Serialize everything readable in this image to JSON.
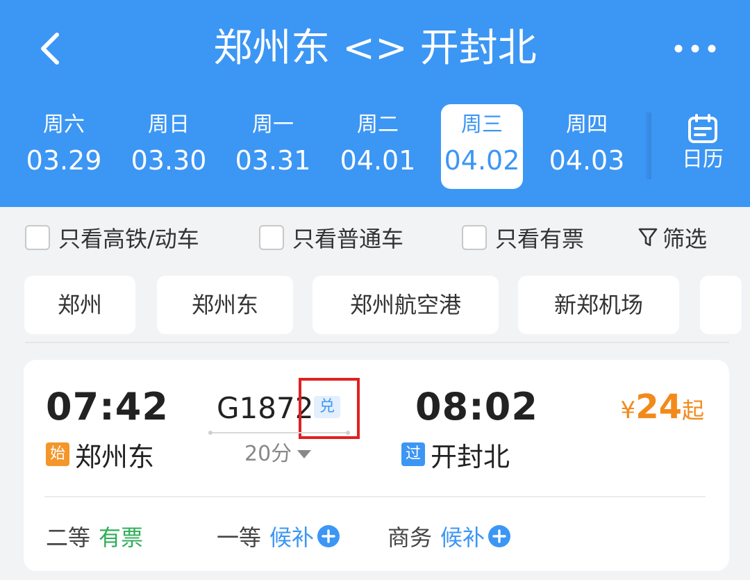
{
  "header": {
    "title": "郑州东 <> 开封北",
    "back_icon": "chevron-left-icon",
    "more_icon": "more-dots-icon"
  },
  "dates": [
    {
      "weekday": "周六",
      "date": "03.29",
      "active": false
    },
    {
      "weekday": "周日",
      "date": "03.30",
      "active": false
    },
    {
      "weekday": "周一",
      "date": "03.31",
      "active": false
    },
    {
      "weekday": "周二",
      "date": "04.01",
      "active": false
    },
    {
      "weekday": "周三",
      "date": "04.02",
      "active": true
    },
    {
      "weekday": "周四",
      "date": "04.03",
      "active": false
    }
  ],
  "calendar": {
    "label": "日历",
    "icon": "calendar-icon"
  },
  "filters": {
    "high_speed": "只看高铁/动车",
    "normal": "只看普通车",
    "available": "只看有票",
    "filter": "筛选"
  },
  "stations": [
    "郑州",
    "郑州东",
    "郑州航空港",
    "新郑机场"
  ],
  "train": {
    "dep_time": "07:42",
    "dep_tag": "始",
    "dep_station": "郑州东",
    "number": "G1872",
    "exchange_badge": "兑",
    "duration": "20分",
    "arr_time": "08:02",
    "arr_tag": "过",
    "arr_station": "开封北",
    "price_currency": "¥",
    "price_amount": "24",
    "price_suffix": "起",
    "seats": [
      {
        "class": "二等",
        "status": "有票"
      },
      {
        "class": "一等",
        "status": "候补"
      },
      {
        "class": "商务",
        "status": "候补"
      }
    ]
  },
  "colors": {
    "header_blue": "#3c96f4",
    "price_orange": "#f28a1b",
    "available_green": "#2fae59",
    "highlight_red": "#e02020"
  }
}
